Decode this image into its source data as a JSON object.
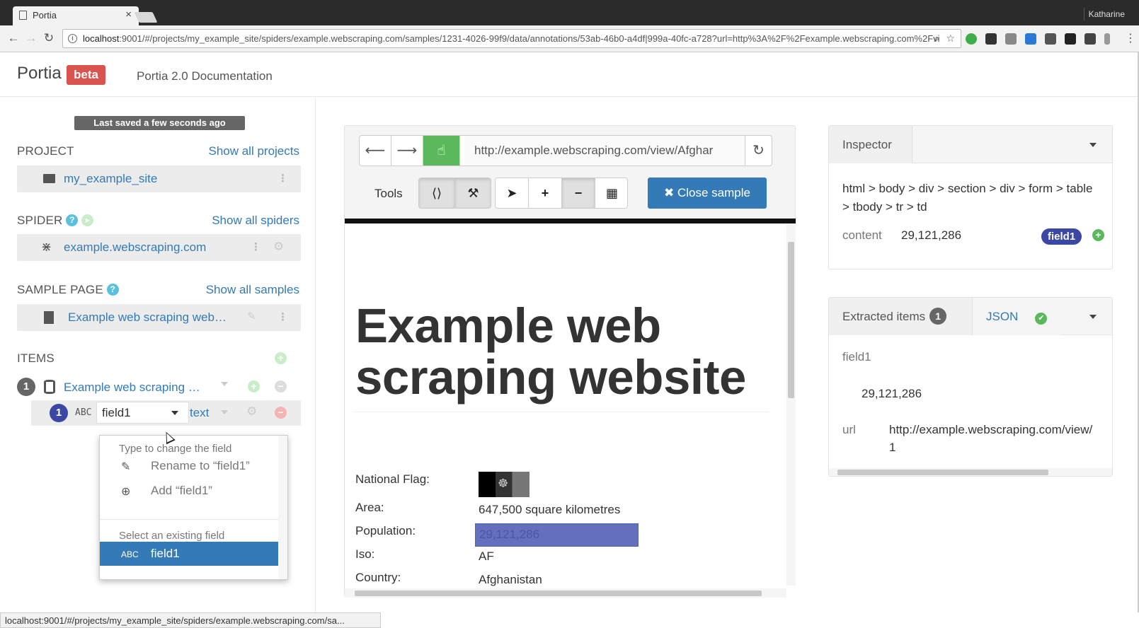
{
  "browser": {
    "tab_title": "Portia",
    "tab_close": "×",
    "user": "Katharine",
    "url_host": "localhost",
    "url_rest": ":9001/#/projects/my_example_site/spiders/example.webscraping.com/samples/1231-4026-99f9/data/annotations/53ab-46b0-a4df|999a-40fc-a728?url=http%3A%2F%2Fexample.webscraping.com%2Fvi",
    "status_url": "localhost:9001/#/projects/my_example_site/spiders/example.webscraping.com/sa..."
  },
  "header": {
    "brand": "Portia",
    "badge": "beta",
    "docs": "Portia 2.0 Documentation"
  },
  "sidebar": {
    "saved": "Last saved a few seconds ago",
    "project_title": "PROJECT",
    "project_link": "Show all projects",
    "project_name": "my_example_site",
    "spider_title": "SPIDER",
    "spider_link": "Show all spiders",
    "spider_name": "example.webscraping.com",
    "sample_title": "SAMPLE PAGE",
    "sample_link": "Show all samples",
    "sample_name": "Example web scraping web…",
    "items_title": "ITEMS",
    "item_count": "1",
    "item_name": "Example web scraping …",
    "field_count": "1",
    "field_type_icon": "ABC",
    "field_value": "field1",
    "field_type": "text"
  },
  "dropdown": {
    "head1": "Type to change the field",
    "rename": "Rename to “field1”",
    "add": "Add “field1”",
    "head2": "Select an existing field",
    "existing_icon": "ABC",
    "existing": "field1"
  },
  "center": {
    "url": "http://example.webscraping.com/view/Afghar",
    "tools_label": "Tools",
    "close_sample": "✖ Close sample",
    "page_title": "Example web scraping website",
    "rows": [
      {
        "label": "National Flag:",
        "value": ""
      },
      {
        "label": "Area:",
        "value": "647,500 square kilometres"
      },
      {
        "label": "Population:",
        "value": "29,121,286"
      },
      {
        "label": "Iso:",
        "value": "AF"
      },
      {
        "label": "Country:",
        "value": "Afghanistan"
      }
    ]
  },
  "inspector": {
    "tab": "Inspector",
    "path": "html > body > div > section > div > form > table > tbody > tr > td",
    "attr": "content",
    "value": "29,121,286",
    "field": "field1"
  },
  "extracted": {
    "tab": "Extracted items",
    "count": "1",
    "json_tab": "JSON",
    "field_key": "field1",
    "field_val": "29,121,286",
    "url_key": "url",
    "url_val": "http://example.webscraping.com/view/",
    "url_val2": "1"
  },
  "colors": {
    "accent": "#337ab7",
    "beta": "#d9534f",
    "green": "#5cb85c",
    "highlight": "#6370bd",
    "field_pill": "#3a47a3"
  }
}
